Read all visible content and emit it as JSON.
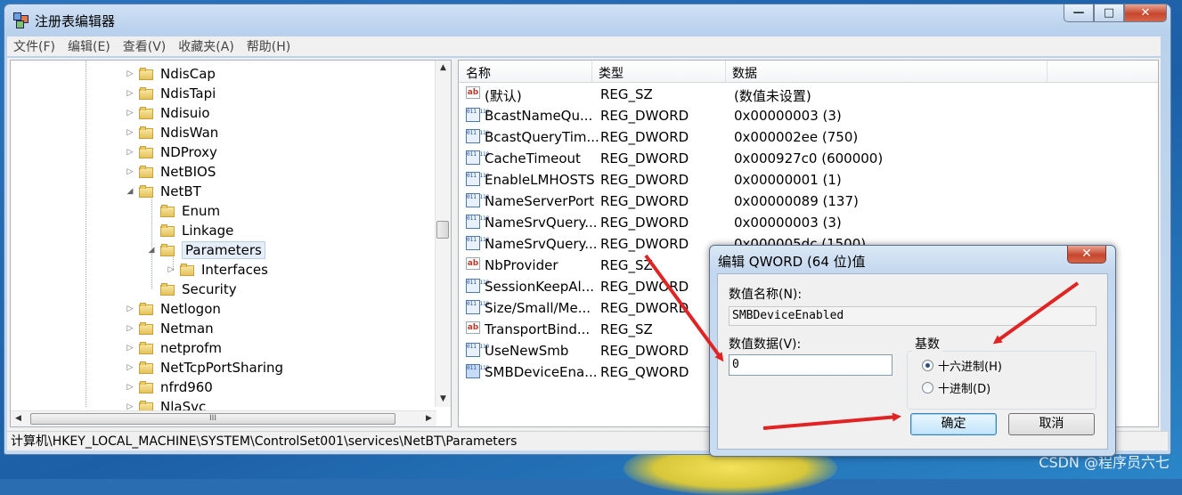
{
  "window": {
    "title": "注册表编辑器",
    "caption_buttons": {
      "minimize": "—",
      "maximize": "□",
      "close": "✕"
    }
  },
  "menu": [
    "文件(F)",
    "编辑(E)",
    "查看(V)",
    "收藏夹(A)",
    "帮助(H)"
  ],
  "tree": {
    "items": [
      {
        "label": "NdisCap",
        "toggle": "▷",
        "level": 0
      },
      {
        "label": "NdisTapi",
        "toggle": "▷",
        "level": 0
      },
      {
        "label": "Ndisuio",
        "toggle": "▷",
        "level": 0
      },
      {
        "label": "NdisWan",
        "toggle": "▷",
        "level": 0
      },
      {
        "label": "NDProxy",
        "toggle": "▷",
        "level": 0
      },
      {
        "label": "NetBIOS",
        "toggle": "▷",
        "level": 0
      },
      {
        "label": "NetBT",
        "toggle": "◢",
        "level": 0
      },
      {
        "label": "Enum",
        "toggle": "",
        "level": 1
      },
      {
        "label": "Linkage",
        "toggle": "",
        "level": 1
      },
      {
        "label": "Parameters",
        "toggle": "◢",
        "level": 1,
        "selected": true
      },
      {
        "label": "Interfaces",
        "toggle": "▷",
        "level": 2
      },
      {
        "label": "Security",
        "toggle": "",
        "level": 1
      },
      {
        "label": "Netlogon",
        "toggle": "▷",
        "level": 0
      },
      {
        "label": "Netman",
        "toggle": "▷",
        "level": 0
      },
      {
        "label": "netprofm",
        "toggle": "▷",
        "level": 0
      },
      {
        "label": "NetTcpPortSharing",
        "toggle": "▷",
        "level": 0
      },
      {
        "label": "nfrd960",
        "toggle": "▷",
        "level": 0
      },
      {
        "label": "NlaSvc",
        "toggle": "▷",
        "level": 0
      }
    ],
    "hscroll_thumb": "III"
  },
  "list": {
    "columns": [
      "名称",
      "类型",
      "数据"
    ],
    "rows": [
      {
        "icon": "string-value-icon",
        "name": "(默认)",
        "type": "REG_SZ",
        "data": "(数值未设置)"
      },
      {
        "icon": "binary-value-icon",
        "name": "BcastNameQu...",
        "type": "REG_DWORD",
        "data": "0x00000003 (3)"
      },
      {
        "icon": "binary-value-icon",
        "name": "BcastQueryTim...",
        "type": "REG_DWORD",
        "data": "0x000002ee (750)"
      },
      {
        "icon": "binary-value-icon",
        "name": "CacheTimeout",
        "type": "REG_DWORD",
        "data": "0x000927c0 (600000)"
      },
      {
        "icon": "binary-value-icon",
        "name": "EnableLMHOSTS",
        "type": "REG_DWORD",
        "data": "0x00000001 (1)"
      },
      {
        "icon": "binary-value-icon",
        "name": "NameServerPort",
        "type": "REG_DWORD",
        "data": "0x00000089 (137)"
      },
      {
        "icon": "binary-value-icon",
        "name": "NameSrvQuery...",
        "type": "REG_DWORD",
        "data": "0x00000003 (3)"
      },
      {
        "icon": "binary-value-icon",
        "name": "NameSrvQuery...",
        "type": "REG_DWORD",
        "data": "0x000005dc (1500)"
      },
      {
        "icon": "string-value-icon",
        "name": "NbProvider",
        "type": "REG_SZ",
        "data": ""
      },
      {
        "icon": "binary-value-icon",
        "name": "SessionKeepAl...",
        "type": "REG_DWORD",
        "data": ""
      },
      {
        "icon": "binary-value-icon",
        "name": "Size/Small/Me...",
        "type": "REG_DWORD",
        "data": ""
      },
      {
        "icon": "string-value-icon",
        "name": "TransportBind...",
        "type": "REG_SZ",
        "data": ""
      },
      {
        "icon": "binary-value-icon",
        "name": "UseNewSmb",
        "type": "REG_DWORD",
        "data": ""
      },
      {
        "icon": "qword-value-icon",
        "name": "SMBDeviceEna...",
        "type": "REG_QWORD",
        "data": ""
      }
    ]
  },
  "status_bar": "计算机\\HKEY_LOCAL_MACHINE\\SYSTEM\\ControlSet001\\services\\NetBT\\Parameters",
  "dialog": {
    "title": "编辑 QWORD (64 位)值",
    "close": "✕",
    "name_label": "数值名称(N):",
    "name_value": "SMBDeviceEnabled",
    "data_label": "数值数据(V):",
    "data_value": "0",
    "base_label": "基数",
    "radio_hex": "十六进制(H)",
    "radio_dec": "十进制(D)",
    "selected_base": "hex",
    "ok": "确定",
    "cancel": "取消"
  },
  "watermark": "CSDN @程序员六七",
  "colors": {
    "annotation_arrow": "#e02424",
    "selection": "#e5eef8"
  }
}
